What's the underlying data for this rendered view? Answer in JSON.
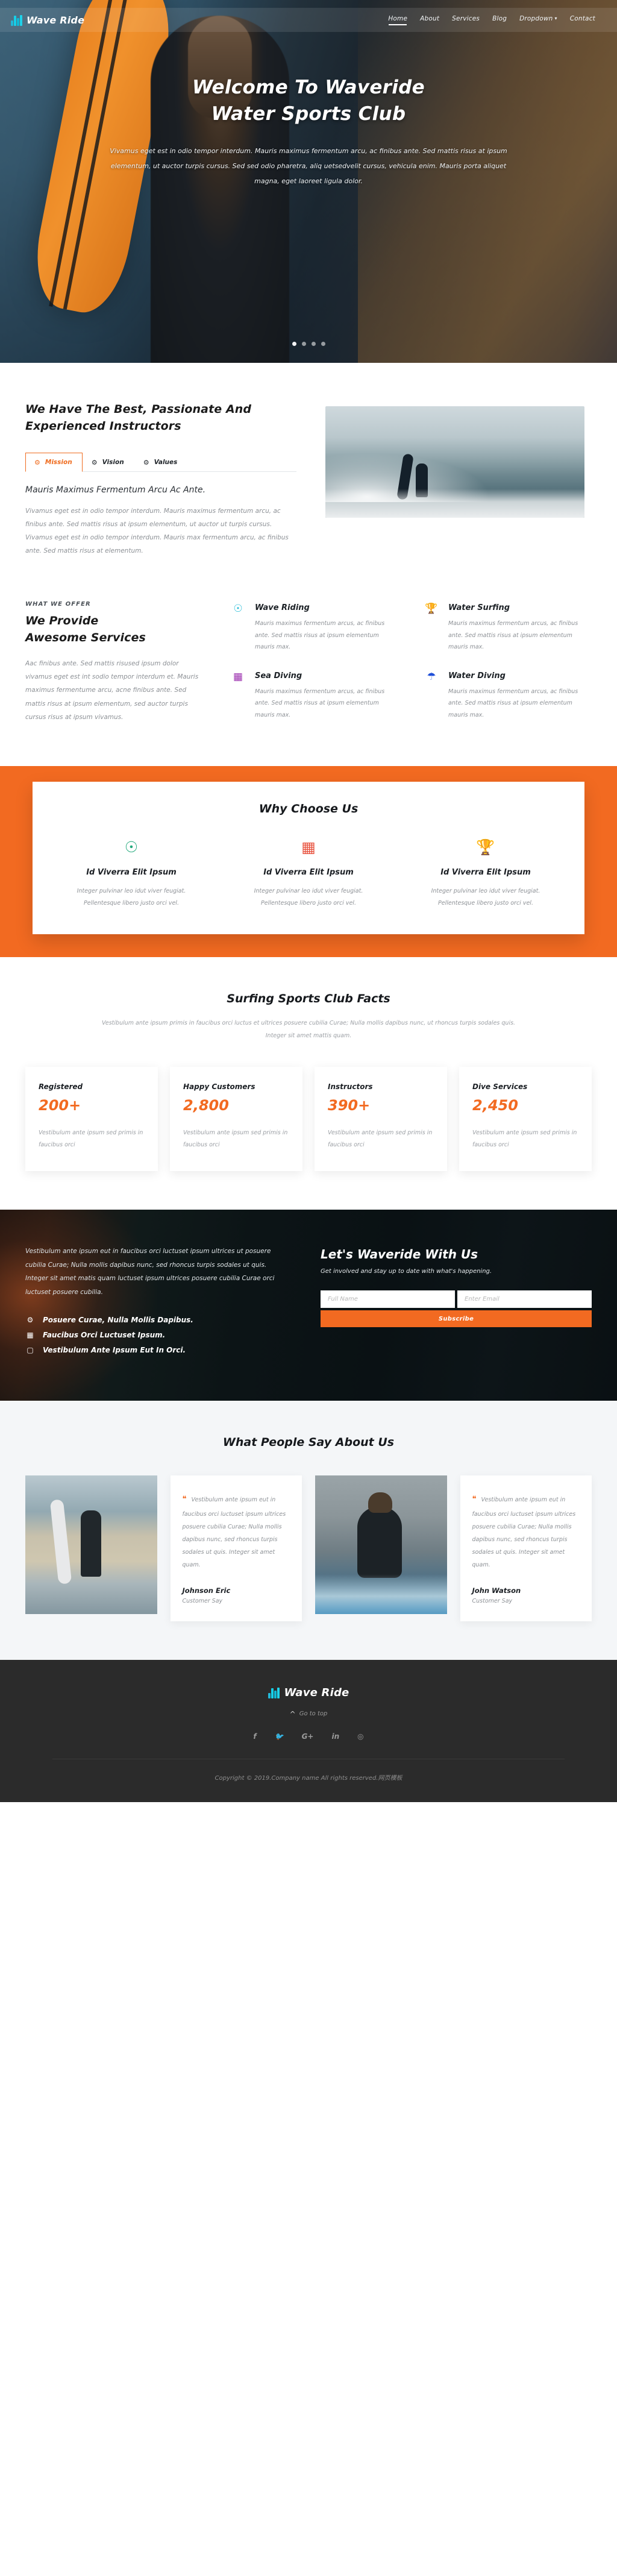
{
  "brand": {
    "name": "Wave Ride",
    "logo_icon": "wave-bars-logo"
  },
  "nav": {
    "items": [
      {
        "label": "Home",
        "active": true
      },
      {
        "label": "About",
        "active": false
      },
      {
        "label": "Services",
        "active": false
      },
      {
        "label": "Blog",
        "active": false
      },
      {
        "label": "Dropdown",
        "active": false,
        "caret": "⌄"
      },
      {
        "label": "Contact",
        "active": false
      }
    ]
  },
  "hero": {
    "title_line1": "Welcome To Waveride",
    "title_line2": "Water Sports Club",
    "paragraph": "Vivamus eget est in odio tempor interdum. Mauris maximus fermentum arcu, ac finibus ante. Sed mattis risus at ipsum elementum, ut auctor turpis cursus. Sed sed odio pharetra, aliq uetsedvelit cursus, vehicula enim. Mauris porta aliquet magna, eget laoreet ligula dolor.",
    "slide_count": 4,
    "active_slide": 1
  },
  "about": {
    "title": "We Have The Best, Passionate And Experienced Instructors",
    "tabs": [
      {
        "label": "Mission",
        "icon": "gears-icon",
        "active": true
      },
      {
        "label": "Vision",
        "icon": "gears-icon",
        "active": false
      },
      {
        "label": "Values",
        "icon": "gears-icon",
        "active": false
      }
    ],
    "panel_heading": "Mauris Maximus Fermentum Arcu Ac Ante.",
    "panel_text": "Vivamus eget est in odio tempor interdum. Mauris maximus fermentum arcu, ac finibus ante. Sed mattis risus at ipsum elementum, ut auctor ut turpis cursus. Vivamus eget est in odio tempor interdum. Mauris max fermentum arcu, ac finibus ante. Sed mattis risus at elementum.",
    "image_alt": "surfer-silhouette-wave-photo"
  },
  "services": {
    "eyebrow": "WHAT WE OFFER",
    "title_line1": "We Provide",
    "title_line2": "Awesome Services",
    "description": "Aac finibus ante. Sed mattis risused ipsum dolor vivamus eget est int sodio tempor interdum et. Mauris maximus fermentume arcu, acne finibus ante. Sed mattis risus at ipsum elementum, sed auctor turpis cursus risus at ipsum vivamus.",
    "items": [
      {
        "title": "Wave Riding",
        "icon": "accessibility-icon",
        "icon_color": "#1fbad6",
        "text": "Mauris maximus fermentum arcus, ac finibus ante. Sed mattis risus at ipsum elementum mauris max."
      },
      {
        "title": "Water Surfing",
        "icon": "trophy-icon",
        "icon_color": "#e8533f",
        "text": "Mauris maximus fermentum arcus, ac finibus ante. Sed mattis risus at ipsum elementum mauris max."
      },
      {
        "title": "Sea Diving",
        "icon": "abacus-icon",
        "icon_color": "#9b2fae",
        "text": "Mauris maximus fermentum arcus, ac finibus ante. Sed mattis risus at ipsum elementum mauris max."
      },
      {
        "title": "Water Diving",
        "icon": "umbrella-icon",
        "icon_color": "#1f4fd8",
        "text": "Mauris maximus fermentum arcus, ac finibus ante. Sed mattis risus at ipsum elementum mauris max."
      }
    ]
  },
  "why": {
    "title": "Why Choose Us",
    "band_color": "#f26a21",
    "items": [
      {
        "title": "Id Viverra Elit Ipsum",
        "icon": "accessibility-icon",
        "icon_color": "#23a97c",
        "text": "Integer pulvinar leo idut viver feugiat. Pellentesque libero justo orci vel."
      },
      {
        "title": "Id Viverra Elit Ipsum",
        "icon": "abacus-icon",
        "icon_color": "#e8533f",
        "text": "Integer pulvinar leo idut viver feugiat. Pellentesque libero justo orci vel."
      },
      {
        "title": "Id Viverra Elit Ipsum",
        "icon": "trophy-icon",
        "icon_color": "#1f77d8",
        "text": "Integer pulvinar leo idut viver feugiat. Pellentesque libero justo orci vel."
      }
    ]
  },
  "facts": {
    "title": "Surfing Sports Club Facts",
    "subtitle": "Vestibulum ante ipsum primis in faucibus orci luctus et ultrices posuere cubilia Curae; Nulla mollis dapibus nunc, ut rhoncus turpis sodales quis. Integer sit amet mattis quam.",
    "items": [
      {
        "label": "Registered",
        "value": "200+",
        "text": "Vestibulum ante ipsum sed primis in faucibus orci"
      },
      {
        "label": "Happy Customers",
        "value": "2,800",
        "text": "Vestibulum ante ipsum sed primis in faucibus orci"
      },
      {
        "label": "Instructors",
        "value": "390+",
        "text": "Vestibulum ante ipsum sed primis in faucibus orci"
      },
      {
        "label": "Dive Services",
        "value": "2,450",
        "text": "Vestibulum ante ipsum sed primis in faucibus orci"
      }
    ],
    "accent_color": "#f26a21"
  },
  "newsletter": {
    "paragraph": "Vestibulum ante ipsum eut in faucibus orci luctuset ipsum ultrices ut posuere cubilia Curae; Nulla mollis dapibus nunc, sed rhoncus turpis sodales ut quis. Integer sit amet matis quam luctuset ipsum ultrices posuere cubilia Curae orci luctuset posuere cubilia.",
    "bullets": [
      {
        "text": "Posuere Curae, Nulla Mollis Dapibus.",
        "icon": "gears-icon"
      },
      {
        "text": "Faucibus Orci Luctuset Ipsum.",
        "icon": "abacus-icon"
      },
      {
        "text": "Vestibulum Ante Ipsum Eut In Orci.",
        "icon": "box-icon"
      }
    ],
    "title": "Let's Waveride With Us",
    "lede": "Get involved and stay up to date with what's happening.",
    "name_placeholder": "Full Name",
    "name_value": "",
    "email_placeholder": "Enter Email",
    "email_value": "",
    "submit_label": "Subscribe"
  },
  "testimonials": {
    "title": "What People Say About Us",
    "items": [
      {
        "photo": "surfer-on-beach-photo",
        "quote": "Vestibulum ante ipsum eut in faucibus orci luctuset ipsum ultrices posuere cubilia Curae; Nulla mollis dapibus nunc, sed rhoncus turpis sodales ut quis. Integer sit amet quam.",
        "name": "Johnson Eric",
        "role": "Customer Say"
      },
      {
        "photo": "surfer-in-wave-photo",
        "quote": "Vestibulum ante ipsum eut in faucibus orci luctuset ipsum ultrices posuere cubilia Curae; Nulla mollis dapibus nunc, sed rhoncus turpis sodales ut quis. Integer sit amet quam.",
        "name": "John Watson",
        "role": "Customer Say"
      }
    ]
  },
  "footer": {
    "brand": "Wave Ride",
    "go_to_top": "Go to top",
    "socials": [
      {
        "name": "facebook-icon",
        "glyph": "f"
      },
      {
        "name": "twitter-icon",
        "glyph": "🐦"
      },
      {
        "name": "google-plus-icon",
        "glyph": "G+"
      },
      {
        "name": "linkedin-icon",
        "glyph": "in"
      },
      {
        "name": "dribbble-icon",
        "glyph": "◎"
      }
    ],
    "copyright": "Copyright © 2019.Company name All rights reserved.网页模板"
  }
}
